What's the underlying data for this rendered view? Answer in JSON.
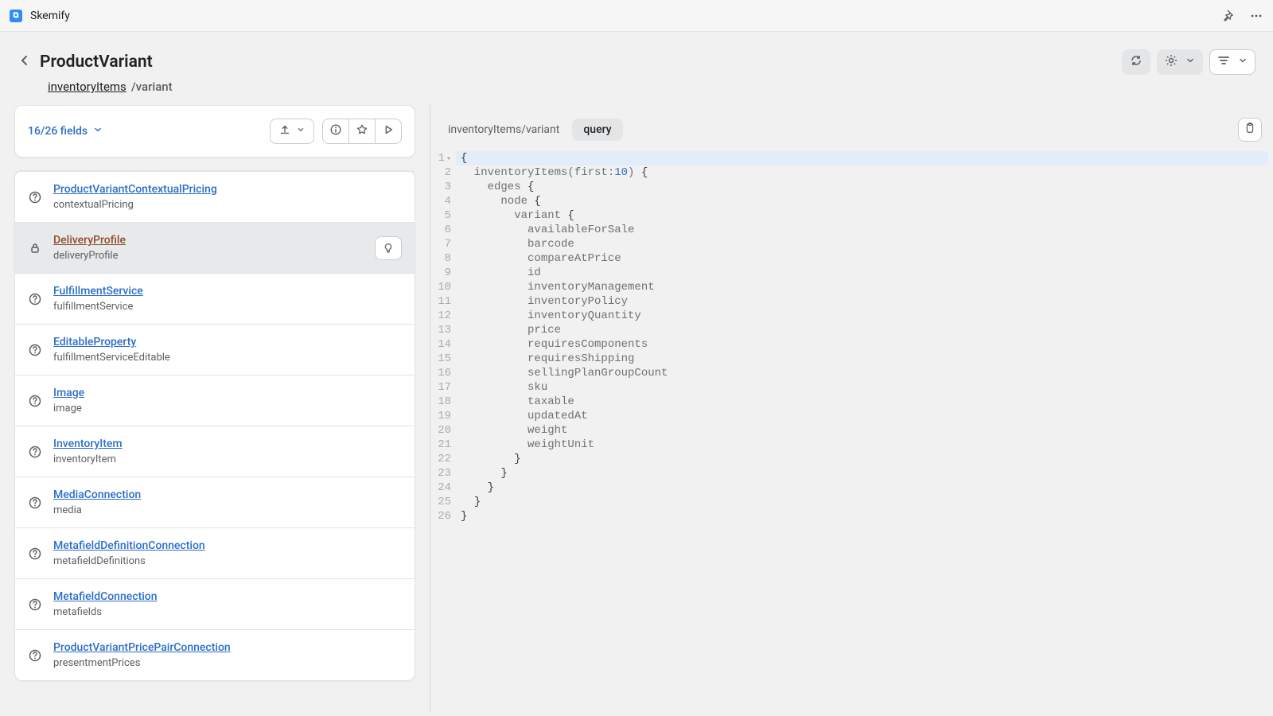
{
  "app": {
    "name": "Skemify"
  },
  "header": {
    "title": "ProductVariant",
    "breadcrumb_link": "inventoryItems",
    "breadcrumb_rest": "/variant"
  },
  "fields_card": {
    "count_label": "16/26 fields"
  },
  "fields": [
    {
      "title": "ProductVariantContextualPricing",
      "sub": "contextualPricing",
      "icon": "help",
      "sel": false
    },
    {
      "title": "DeliveryProfile",
      "sub": "deliveryProfile",
      "icon": "lock",
      "sel": true,
      "idea": true
    },
    {
      "title": "FulfillmentService",
      "sub": "fulfillmentService",
      "icon": "help",
      "sel": false
    },
    {
      "title": "EditableProperty",
      "sub": "fulfillmentServiceEditable",
      "icon": "help",
      "sel": false
    },
    {
      "title": "Image",
      "sub": "image",
      "icon": "help",
      "sel": false
    },
    {
      "title": "InventoryItem",
      "sub": "inventoryItem",
      "icon": "help",
      "sel": false
    },
    {
      "title": "MediaConnection",
      "sub": "media",
      "icon": "help",
      "sel": false
    },
    {
      "title": "MetafieldDefinitionConnection",
      "sub": "metafieldDefinitions",
      "icon": "help",
      "sel": false
    },
    {
      "title": "MetafieldConnection",
      "sub": "metafields",
      "icon": "help",
      "sel": false
    },
    {
      "title": "ProductVariantPricePairConnection",
      "sub": "presentmentPrices",
      "icon": "help",
      "sel": false
    }
  ],
  "editor": {
    "path": "inventoryItems/variant",
    "pill": "query",
    "lines": [
      {
        "text": "{",
        "hl": true,
        "fold": true
      },
      {
        "text": "  inventoryItems(first:10) {",
        "num": "10"
      },
      {
        "text": "    edges {"
      },
      {
        "text": "      node {"
      },
      {
        "text": "        variant {"
      },
      {
        "text": "          availableForSale"
      },
      {
        "text": "          barcode"
      },
      {
        "text": "          compareAtPrice"
      },
      {
        "text": "          id"
      },
      {
        "text": "          inventoryManagement"
      },
      {
        "text": "          inventoryPolicy"
      },
      {
        "text": "          inventoryQuantity"
      },
      {
        "text": "          price"
      },
      {
        "text": "          requiresComponents"
      },
      {
        "text": "          requiresShipping"
      },
      {
        "text": "          sellingPlanGroupCount"
      },
      {
        "text": "          sku"
      },
      {
        "text": "          taxable"
      },
      {
        "text": "          updatedAt"
      },
      {
        "text": "          weight"
      },
      {
        "text": "          weightUnit"
      },
      {
        "text": "        }"
      },
      {
        "text": "      }"
      },
      {
        "text": "    }"
      },
      {
        "text": "  }"
      },
      {
        "text": "}"
      }
    ]
  }
}
